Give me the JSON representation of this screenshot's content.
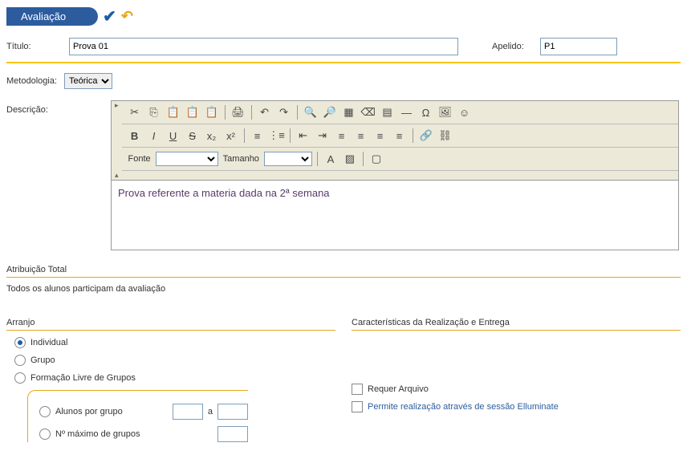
{
  "header": {
    "tab": "Avaliação"
  },
  "fields": {
    "titulo_label": "Título:",
    "titulo_value": "Prova 01",
    "apelido_label": "Apelido:",
    "apelido_value": "P1",
    "metodologia_label": "Metodologia:",
    "metodologia_value": "Teórica",
    "descricao_label": "Descrição:"
  },
  "editor": {
    "fonte_label": "Fonte",
    "tamanho_label": "Tamanho",
    "content": "Prova referente a materia dada na 2ª semana"
  },
  "atribuicao": {
    "title": "Atribuição Total",
    "text": "Todos os alunos participam da avaliação"
  },
  "arranjo": {
    "title": "Arranjo",
    "opt_individual": "Individual",
    "opt_grupo": "Grupo",
    "opt_formacao": "Formação Livre de Grupos",
    "sub_alunos": "Alunos por grupo",
    "sub_a": "a",
    "sub_max": "Nº máximo de grupos"
  },
  "caracteristicas": {
    "title": "Características da Realização e Entrega",
    "requer_arquivo": "Requer Arquivo",
    "permite_elluminate": "Permite realização através de sessão Elluminate"
  }
}
